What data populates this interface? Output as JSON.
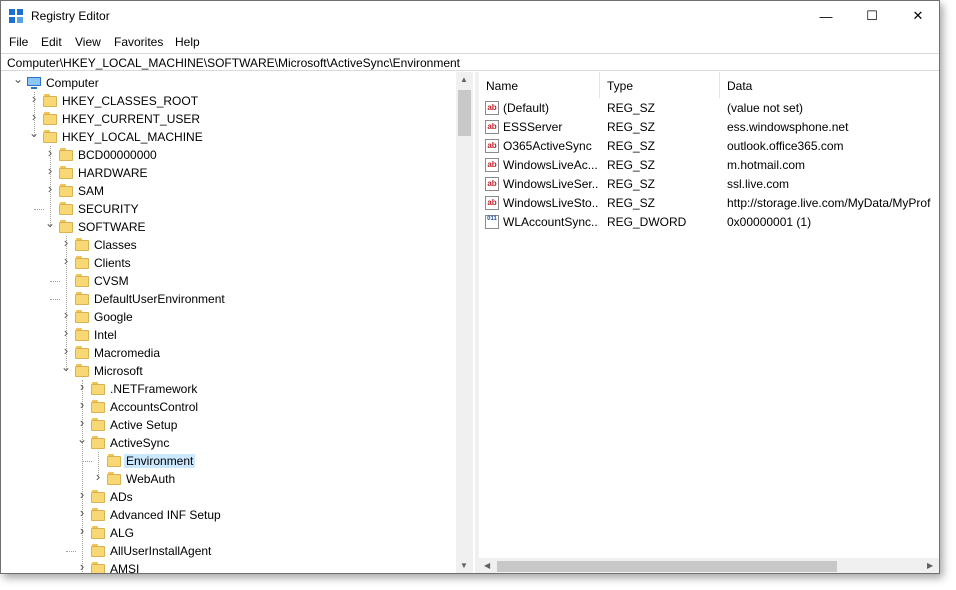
{
  "window": {
    "title": "Registry Editor"
  },
  "title_controls": {
    "minimize": "—",
    "maximize": "☐",
    "close": "✕"
  },
  "menu": [
    "File",
    "Edit",
    "View",
    "Favorites",
    "Help"
  ],
  "address": "Computer\\HKEY_LOCAL_MACHINE\\SOFTWARE\\Microsoft\\ActiveSync\\Environment",
  "tree": [
    {
      "label": "Computer",
      "depth": 0,
      "expanded": true,
      "kind": "computer"
    },
    {
      "label": "HKEY_CLASSES_ROOT",
      "depth": 1,
      "expanded": false
    },
    {
      "label": "HKEY_CURRENT_USER",
      "depth": 1,
      "expanded": false
    },
    {
      "label": "HKEY_LOCAL_MACHINE",
      "depth": 1,
      "expanded": true
    },
    {
      "label": "BCD00000000",
      "depth": 2,
      "expanded": false
    },
    {
      "label": "HARDWARE",
      "depth": 2,
      "expanded": false
    },
    {
      "label": "SAM",
      "depth": 2,
      "expanded": false
    },
    {
      "label": "SECURITY",
      "depth": 2,
      "leaf": true
    },
    {
      "label": "SOFTWARE",
      "depth": 2,
      "expanded": true
    },
    {
      "label": "Classes",
      "depth": 3,
      "expanded": false
    },
    {
      "label": "Clients",
      "depth": 3,
      "expanded": false
    },
    {
      "label": "CVSM",
      "depth": 3,
      "leaf": true
    },
    {
      "label": "DefaultUserEnvironment",
      "depth": 3,
      "leaf": true
    },
    {
      "label": "Google",
      "depth": 3,
      "expanded": false
    },
    {
      "label": "Intel",
      "depth": 3,
      "expanded": false
    },
    {
      "label": "Macromedia",
      "depth": 3,
      "expanded": false
    },
    {
      "label": "Microsoft",
      "depth": 3,
      "expanded": true
    },
    {
      "label": ".NETFramework",
      "depth": 4,
      "expanded": false
    },
    {
      "label": "AccountsControl",
      "depth": 4,
      "expanded": false
    },
    {
      "label": "Active Setup",
      "depth": 4,
      "expanded": false
    },
    {
      "label": "ActiveSync",
      "depth": 4,
      "expanded": true
    },
    {
      "label": "Environment",
      "depth": 5,
      "leaf": true,
      "selected": true
    },
    {
      "label": "WebAuth",
      "depth": 5,
      "expanded": false
    },
    {
      "label": "ADs",
      "depth": 4,
      "expanded": false
    },
    {
      "label": "Advanced INF Setup",
      "depth": 4,
      "expanded": false
    },
    {
      "label": "ALG",
      "depth": 4,
      "expanded": false
    },
    {
      "label": "AllUserInstallAgent",
      "depth": 4,
      "leaf": true
    },
    {
      "label": "AMSI",
      "depth": 4,
      "expanded": false
    }
  ],
  "columns": {
    "name": "Name",
    "type": "Type",
    "data": "Data"
  },
  "values": [
    {
      "name": "(Default)",
      "type": "REG_SZ",
      "data": "(value not set)",
      "icon": "string-value-icon"
    },
    {
      "name": "ESSServer",
      "type": "REG_SZ",
      "data": "ess.windowsphone.net",
      "icon": "string-value-icon"
    },
    {
      "name": "O365ActiveSync",
      "type": "REG_SZ",
      "data": "outlook.office365.com",
      "icon": "string-value-icon"
    },
    {
      "name": "WindowsLiveAc...",
      "type": "REG_SZ",
      "data": "m.hotmail.com",
      "icon": "string-value-icon"
    },
    {
      "name": "WindowsLiveSer...",
      "type": "REG_SZ",
      "data": "ssl.live.com",
      "icon": "string-value-icon"
    },
    {
      "name": "WindowsLiveSto...",
      "type": "REG_SZ",
      "data": "http://storage.live.com/MyData/MyProf",
      "icon": "string-value-icon"
    },
    {
      "name": "WLAccountSync...",
      "type": "REG_DWORD",
      "data": "0x00000001 (1)",
      "icon": "dword-value-icon"
    }
  ],
  "icon_glyphs": {
    "string": "ab",
    "dword": "011"
  },
  "colors": {
    "selection": "#cce8ff",
    "folder": "#f8d775"
  }
}
